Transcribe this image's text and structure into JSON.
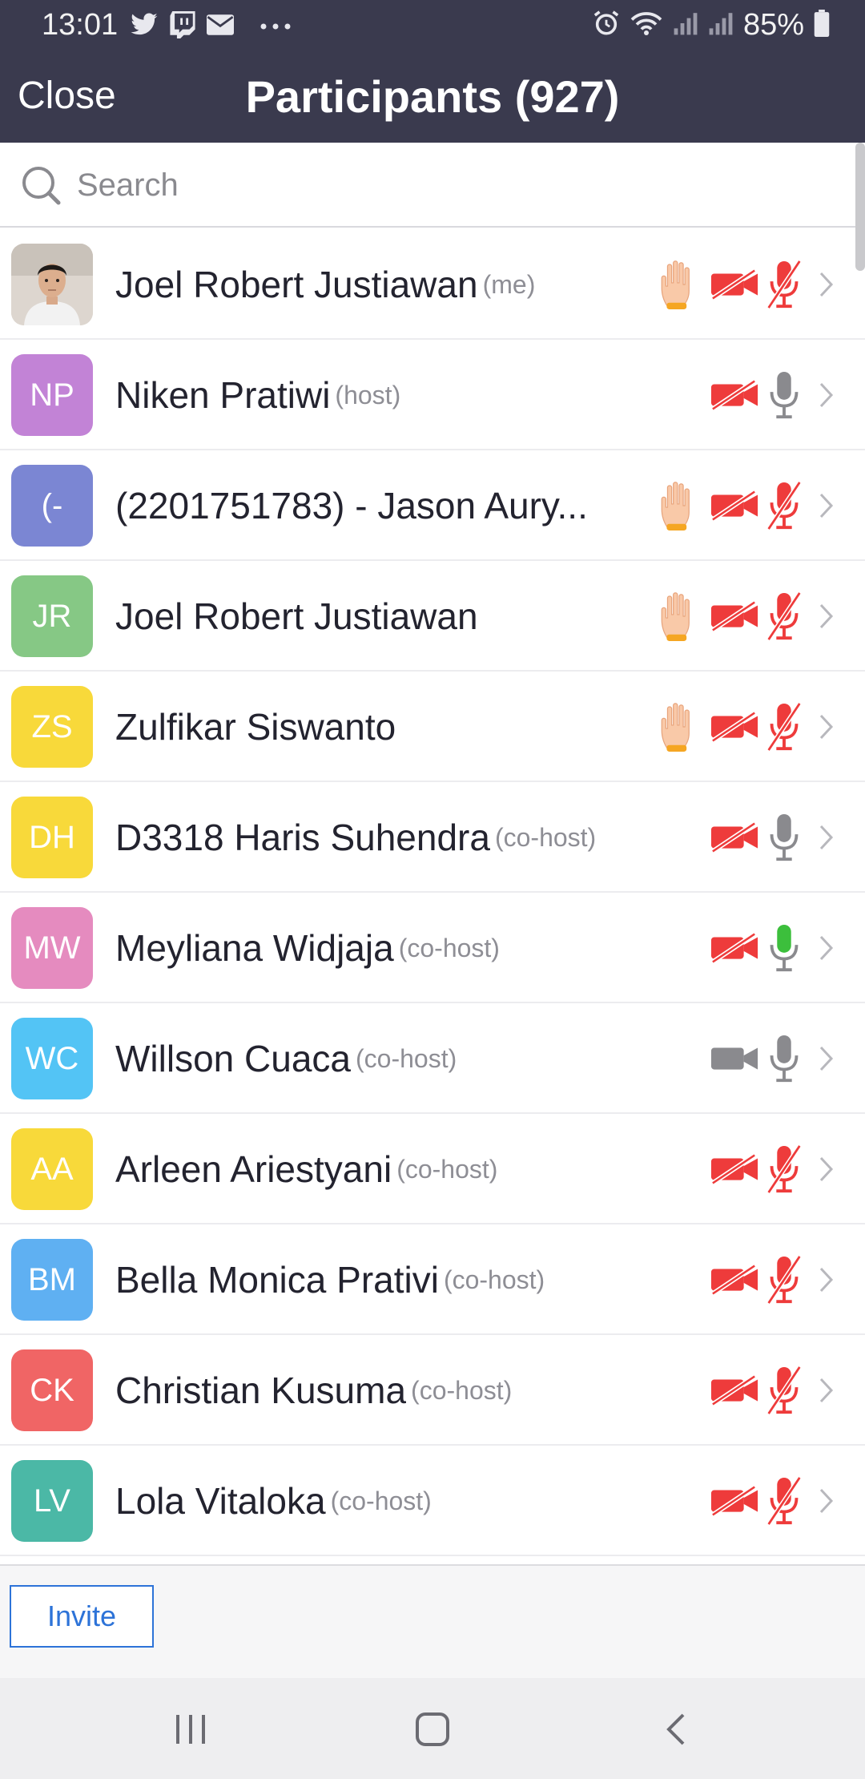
{
  "status_bar": {
    "time": "13:01",
    "left_icons": [
      "twitter-icon",
      "twitch-icon",
      "mail-icon",
      "more-icon"
    ],
    "right_icons": [
      "alarm-icon",
      "wifi-icon",
      "signal-icon",
      "signal-icon",
      "battery-icon"
    ],
    "battery": "85%"
  },
  "header": {
    "close_label": "Close",
    "title": "Participants (927)"
  },
  "search": {
    "placeholder": "Search"
  },
  "participants": [
    {
      "name": "Joel Robert Justiawan",
      "role": "(me)",
      "initials": "",
      "avatar_color": "#d8d0c8",
      "photo": true,
      "hand": true,
      "video": "off",
      "mic": "muted"
    },
    {
      "name": "Niken Pratiwi",
      "role": "(host)",
      "initials": "NP",
      "avatar_color": "#c283d6",
      "photo": false,
      "hand": false,
      "video": "off",
      "mic": "on"
    },
    {
      "name": "(2201751783) - Jason Aury...",
      "role": "",
      "initials": "(-",
      "avatar_color": "#7b86d3",
      "photo": false,
      "hand": true,
      "video": "off",
      "mic": "muted"
    },
    {
      "name": "Joel Robert Justiawan",
      "role": "",
      "initials": "JR",
      "avatar_color": "#86c885",
      "photo": false,
      "hand": true,
      "video": "off",
      "mic": "muted"
    },
    {
      "name": "Zulfikar Siswanto",
      "role": "",
      "initials": "ZS",
      "avatar_color": "#f8d93a",
      "photo": false,
      "hand": true,
      "video": "off",
      "mic": "muted"
    },
    {
      "name": "D3318 Haris Suhendra",
      "role": "(co-host)",
      "initials": "DH",
      "avatar_color": "#f8d93a",
      "photo": false,
      "hand": false,
      "video": "off",
      "mic": "on"
    },
    {
      "name": "Meyliana Widjaja",
      "role": "(co-host)",
      "initials": "MW",
      "avatar_color": "#e58bbf",
      "photo": false,
      "hand": false,
      "video": "off",
      "mic": "speaking"
    },
    {
      "name": "Willson Cuaca",
      "role": "(co-host)",
      "initials": "WC",
      "avatar_color": "#53c4f5",
      "photo": false,
      "hand": false,
      "video": "on",
      "mic": "on"
    },
    {
      "name": "Arleen Ariestyani",
      "role": "(co-host)",
      "initials": "AA",
      "avatar_color": "#f8d93a",
      "photo": false,
      "hand": false,
      "video": "off",
      "mic": "muted"
    },
    {
      "name": "Bella Monica Prativi",
      "role": "(co-host)",
      "initials": "BM",
      "avatar_color": "#5fb0f2",
      "photo": false,
      "hand": false,
      "video": "off",
      "mic": "muted"
    },
    {
      "name": "Christian Kusuma",
      "role": "(co-host)",
      "initials": "CK",
      "avatar_color": "#f06565",
      "photo": false,
      "hand": false,
      "video": "off",
      "mic": "muted"
    },
    {
      "name": "Lola Vitaloka",
      "role": "(co-host)",
      "initials": "LV",
      "avatar_color": "#4bb8a6",
      "photo": false,
      "hand": false,
      "video": "off",
      "mic": "muted"
    }
  ],
  "footer": {
    "invite_label": "Invite"
  },
  "nav_bar": {
    "buttons": [
      "recent-apps-icon",
      "home-icon",
      "back-icon"
    ]
  },
  "colors": {
    "header_bg": "#3a3a4e",
    "muted_red": "#ee3b3b",
    "neutral_gray": "#8a8a8e",
    "speaking_green": "#3cbf3c",
    "hand_color": "#f9c9a8",
    "accent_blue": "#2d73d8"
  }
}
